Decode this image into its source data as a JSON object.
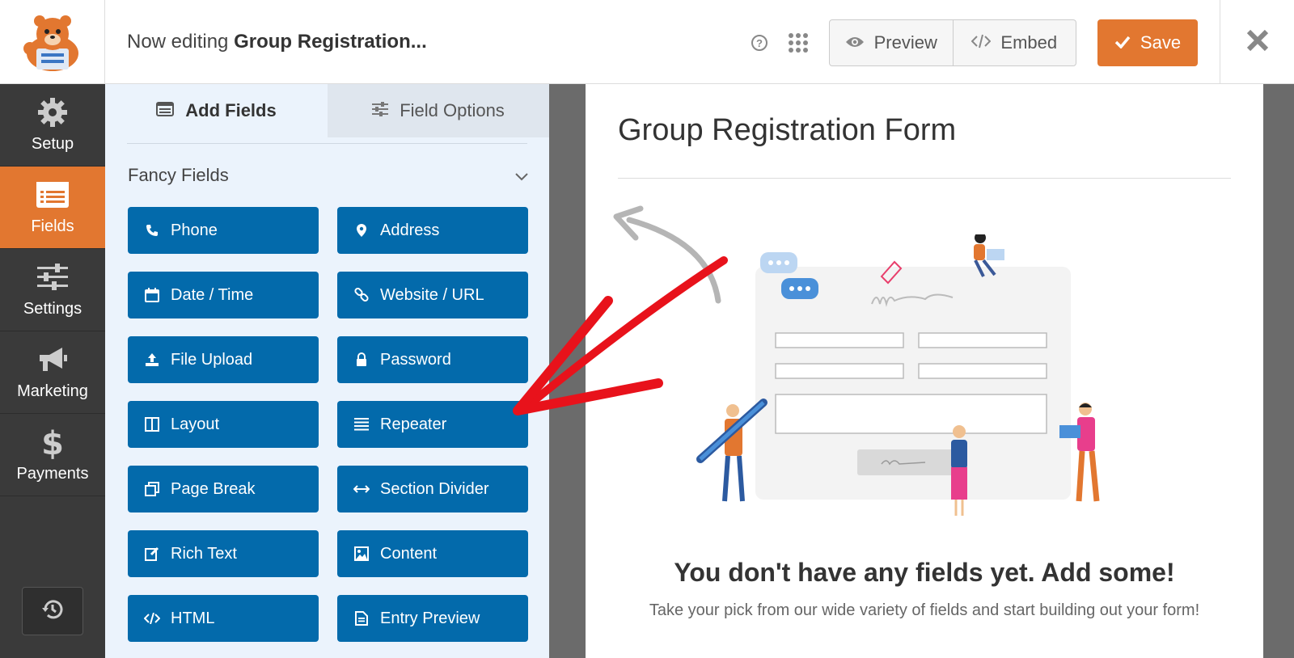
{
  "header": {
    "title_prefix": "Now editing ",
    "title_form": "Group Registration...",
    "preview_label": "Preview",
    "embed_label": "Embed",
    "save_label": "Save"
  },
  "nav": {
    "items": [
      {
        "label": "Setup",
        "icon": "gear-icon"
      },
      {
        "label": "Fields",
        "icon": "fields-list-icon",
        "active": true
      },
      {
        "label": "Settings",
        "icon": "sliders-icon"
      },
      {
        "label": "Marketing",
        "icon": "megaphone-icon"
      },
      {
        "label": "Payments",
        "icon": "dollar-icon"
      }
    ]
  },
  "panel": {
    "tabs": [
      {
        "label": "Add Fields",
        "active": true
      },
      {
        "label": "Field Options",
        "active": false
      }
    ],
    "section_title": "Fancy Fields",
    "fields": [
      {
        "label": "Phone",
        "icon": "phone-icon"
      },
      {
        "label": "Address",
        "icon": "map-pin-icon"
      },
      {
        "label": "Date / Time",
        "icon": "calendar-icon"
      },
      {
        "label": "Website / URL",
        "icon": "link-icon"
      },
      {
        "label": "File Upload",
        "icon": "upload-icon"
      },
      {
        "label": "Password",
        "icon": "lock-icon"
      },
      {
        "label": "Layout",
        "icon": "columns-icon"
      },
      {
        "label": "Repeater",
        "icon": "list-icon"
      },
      {
        "label": "Page Break",
        "icon": "copy-icon"
      },
      {
        "label": "Section Divider",
        "icon": "arrows-h-icon"
      },
      {
        "label": "Rich Text",
        "icon": "edit-icon"
      },
      {
        "label": "Content",
        "icon": "image-icon"
      },
      {
        "label": "HTML",
        "icon": "code-icon"
      },
      {
        "label": "Entry Preview",
        "icon": "file-text-icon"
      }
    ]
  },
  "form": {
    "title": "Group Registration Form",
    "empty_title": "You don't have any fields yet. Add some!",
    "empty_subtitle": "Take your pick from our wide variety of fields and start building out your form!"
  },
  "colors": {
    "accent_orange": "#e27730",
    "field_button_blue": "#036aab",
    "nav_dark": "#3a3a3a",
    "panel_bg": "#ebf3fc",
    "annotation_red": "#e8121b"
  }
}
